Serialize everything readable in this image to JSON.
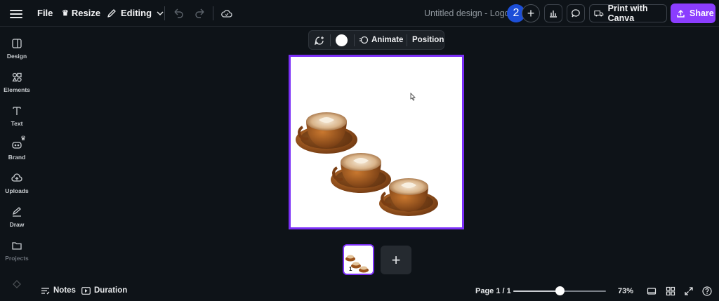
{
  "topbar": {
    "file_label": "File",
    "resize_label": "Resize",
    "editing_label": "Editing",
    "doc_title": "Untitled design - Logo",
    "collaborator_initial": "2",
    "add_collaborator": "+",
    "print_label": "Print with Canva",
    "share_label": "Share"
  },
  "sidebar": {
    "items": [
      {
        "label": "Design",
        "icon": "design-icon"
      },
      {
        "label": "Elements",
        "icon": "elements-icon"
      },
      {
        "label": "Text",
        "icon": "text-icon"
      },
      {
        "label": "Brand",
        "icon": "brand-icon"
      },
      {
        "label": "Uploads",
        "icon": "uploads-icon"
      },
      {
        "label": "Draw",
        "icon": "draw-icon"
      },
      {
        "label": "Projects",
        "icon": "projects-icon"
      }
    ]
  },
  "floating_toolbar": {
    "animate_label": "Animate",
    "position_label": "Position",
    "color_swatch": "#ffffff"
  },
  "pages": {
    "thumb_number": "1",
    "add_page": "+"
  },
  "bottombar": {
    "notes_label": "Notes",
    "duration_label": "Duration",
    "page_indicator": "Page 1 / 1",
    "zoom_label": "73%",
    "zoom_slider_fraction": 0.5
  },
  "colors": {
    "accent": "#7b2ff7",
    "share": "#8b3dff",
    "avatar": "#1d4fd8",
    "background": "#0e1318"
  }
}
